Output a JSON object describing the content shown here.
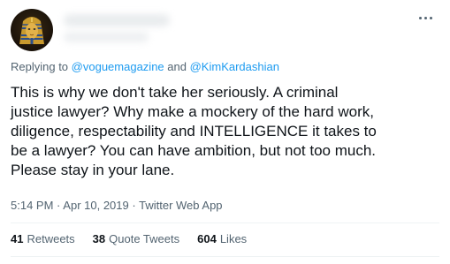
{
  "tweet": {
    "more_icon": "more-horizontal-icon",
    "avatar_icon": "pharaoh-mask-avatar",
    "reply": {
      "prefix": "Replying to",
      "mention1": "@voguemagazine",
      "connector": "and",
      "mention2": "@KimKardashian"
    },
    "text": "This is why we don't take her seriously. A criminal\njustice lawyer? Why make a mockery of the hard work,\ndiligence, respectability and INTELLIGENCE it takes to\nbe a lawyer? You can have ambition, but not too much.\nPlease stay in your lane.",
    "time": "5:14 PM",
    "sep1": "·",
    "date": "Apr 10, 2019",
    "sep2": "·",
    "source": "Twitter Web App",
    "stats": {
      "retweets_count": "41",
      "retweets_label": "Retweets",
      "quotes_count": "38",
      "quotes_label": "Quote Tweets",
      "likes_count": "604",
      "likes_label": "Likes"
    }
  },
  "colors": {
    "link": "#1d9bf0",
    "secondary_text": "#536471",
    "primary_text": "#0f1419"
  }
}
